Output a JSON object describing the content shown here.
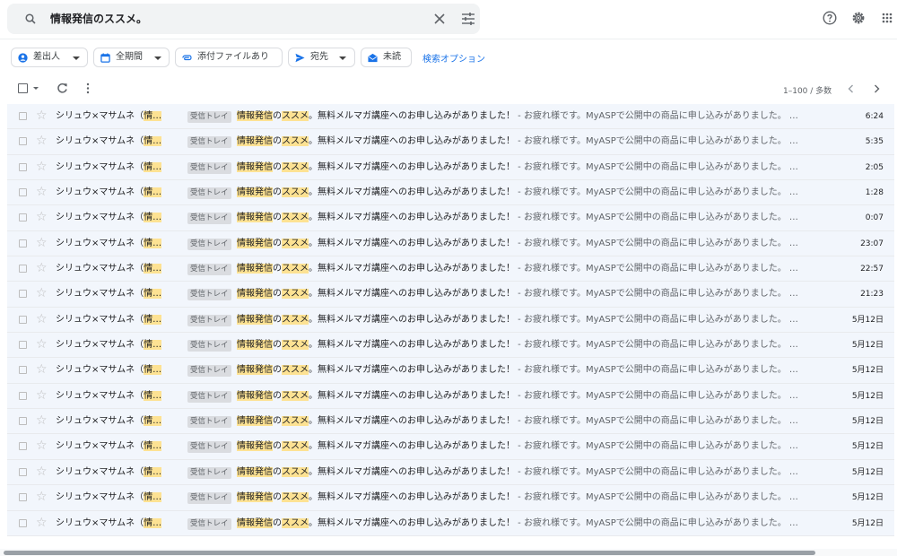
{
  "search": {
    "query": "情報発信のススメ。"
  },
  "filters": {
    "sender": "差出人",
    "period": "全期間",
    "attachment": "添付ファイルあり",
    "to": "宛先",
    "unread": "未読",
    "search_options": "検索オプション"
  },
  "pagination": {
    "label": "1–100 / 多数"
  },
  "colors": {
    "accent": "#1a73e8",
    "highlight": "#fde293",
    "row_bg": "#f2f6fc"
  },
  "icons": [
    "search-icon",
    "close-icon",
    "tune-icon",
    "help-icon",
    "gear-icon",
    "apps-icon",
    "person-icon",
    "calendar-icon",
    "attachment-icon",
    "send-icon",
    "unread-icon",
    "refresh-icon",
    "more-vert-icon",
    "chevron-left-icon",
    "chevron-right-icon",
    "star-icon"
  ],
  "emails": [
    {
      "sender_pre": "シリュウ×マサムネ（",
      "sender_hl": "情…",
      "label": "受信トレイ",
      "subj_hl1": "情報発信",
      "subj_mid": "の",
      "subj_hl2": "ススメ",
      "subj_rest": "。無料メルマガ講座へのお申し込みがありました！",
      "snippet": " - お疲れ様です。MyASPで公開中の商品に申し込みがありました。 …",
      "time": "6:24"
    },
    {
      "sender_pre": "シリュウ×マサムネ（",
      "sender_hl": "情…",
      "label": "受信トレイ",
      "subj_hl1": "情報発信",
      "subj_mid": "の",
      "subj_hl2": "ススメ",
      "subj_rest": "。無料メルマガ講座へのお申し込みがありました！",
      "snippet": " - お疲れ様です。MyASPで公開中の商品に申し込みがありました。 …",
      "time": "5:35"
    },
    {
      "sender_pre": "シリュウ×マサムネ（",
      "sender_hl": "情…",
      "label": "受信トレイ",
      "subj_hl1": "情報発信",
      "subj_mid": "の",
      "subj_hl2": "ススメ",
      "subj_rest": "。無料メルマガ講座へのお申し込みがありました！",
      "snippet": " - お疲れ様です。MyASPで公開中の商品に申し込みがありました。 …",
      "time": "2:05"
    },
    {
      "sender_pre": "シリュウ×マサムネ（",
      "sender_hl": "情…",
      "label": "受信トレイ",
      "subj_hl1": "情報発信",
      "subj_mid": "の",
      "subj_hl2": "ススメ",
      "subj_rest": "。無料メルマガ講座へのお申し込みがありました！",
      "snippet": " - お疲れ様です。MyASPで公開中の商品に申し込みがありました。 …",
      "time": "1:28"
    },
    {
      "sender_pre": "シリュウ×マサムネ（",
      "sender_hl": "情…",
      "label": "受信トレイ",
      "subj_hl1": "情報発信",
      "subj_mid": "の",
      "subj_hl2": "ススメ",
      "subj_rest": "。無料メルマガ講座へのお申し込みがありました！",
      "snippet": " - お疲れ様です。MyASPで公開中の商品に申し込みがありました。 …",
      "time": "0:07"
    },
    {
      "sender_pre": "シリュウ×マサムネ（",
      "sender_hl": "情…",
      "label": "受信トレイ",
      "subj_hl1": "情報発信",
      "subj_mid": "の",
      "subj_hl2": "ススメ",
      "subj_rest": "。無料メルマガ講座へのお申し込みがありました！",
      "snippet": " - お疲れ様です。MyASPで公開中の商品に申し込みがありました。 …",
      "time": "23:07"
    },
    {
      "sender_pre": "シリュウ×マサムネ（",
      "sender_hl": "情…",
      "label": "受信トレイ",
      "subj_hl1": "情報発信",
      "subj_mid": "の",
      "subj_hl2": "ススメ",
      "subj_rest": "。無料メルマガ講座へのお申し込みがありました！",
      "snippet": " - お疲れ様です。MyASPで公開中の商品に申し込みがありました。 …",
      "time": "22:57"
    },
    {
      "sender_pre": "シリュウ×マサムネ（",
      "sender_hl": "情…",
      "label": "受信トレイ",
      "subj_hl1": "情報発信",
      "subj_mid": "の",
      "subj_hl2": "ススメ",
      "subj_rest": "。無料メルマガ講座へのお申し込みがありました！",
      "snippet": " - お疲れ様です。MyASPで公開中の商品に申し込みがありました。 …",
      "time": "21:23"
    },
    {
      "sender_pre": "シリュウ×マサムネ（",
      "sender_hl": "情…",
      "label": "受信トレイ",
      "subj_hl1": "情報発信",
      "subj_mid": "の",
      "subj_hl2": "ススメ",
      "subj_rest": "。無料メルマガ講座へのお申し込みがありました！",
      "snippet": " - お疲れ様です。MyASPで公開中の商品に申し込みがありました。 …",
      "time": "5月12日"
    },
    {
      "sender_pre": "シリュウ×マサムネ（",
      "sender_hl": "情…",
      "label": "受信トレイ",
      "subj_hl1": "情報発信",
      "subj_mid": "の",
      "subj_hl2": "ススメ",
      "subj_rest": "。無料メルマガ講座へのお申し込みがありました！",
      "snippet": " - お疲れ様です。MyASPで公開中の商品に申し込みがありました。 …",
      "time": "5月12日"
    },
    {
      "sender_pre": "シリュウ×マサムネ（",
      "sender_hl": "情…",
      "label": "受信トレイ",
      "subj_hl1": "情報発信",
      "subj_mid": "の",
      "subj_hl2": "ススメ",
      "subj_rest": "。無料メルマガ講座へのお申し込みがありました！",
      "snippet": " - お疲れ様です。MyASPで公開中の商品に申し込みがありました。 …",
      "time": "5月12日"
    },
    {
      "sender_pre": "シリュウ×マサムネ（",
      "sender_hl": "情…",
      "label": "受信トレイ",
      "subj_hl1": "情報発信",
      "subj_mid": "の",
      "subj_hl2": "ススメ",
      "subj_rest": "。無料メルマガ講座へのお申し込みがありました！",
      "snippet": " - お疲れ様です。MyASPで公開中の商品に申し込みがありました。 …",
      "time": "5月12日"
    },
    {
      "sender_pre": "シリュウ×マサムネ（",
      "sender_hl": "情…",
      "label": "受信トレイ",
      "subj_hl1": "情報発信",
      "subj_mid": "の",
      "subj_hl2": "ススメ",
      "subj_rest": "。無料メルマガ講座へのお申し込みがありました！",
      "snippet": " - お疲れ様です。MyASPで公開中の商品に申し込みがありました。 …",
      "time": "5月12日"
    },
    {
      "sender_pre": "シリュウ×マサムネ（",
      "sender_hl": "情…",
      "label": "受信トレイ",
      "subj_hl1": "情報発信",
      "subj_mid": "の",
      "subj_hl2": "ススメ",
      "subj_rest": "。無料メルマガ講座へのお申し込みがありました！",
      "snippet": " - お疲れ様です。MyASPで公開中の商品に申し込みがありました。 …",
      "time": "5月12日"
    },
    {
      "sender_pre": "シリュウ×マサムネ（",
      "sender_hl": "情…",
      "label": "受信トレイ",
      "subj_hl1": "情報発信",
      "subj_mid": "の",
      "subj_hl2": "ススメ",
      "subj_rest": "。無料メルマガ講座へのお申し込みがありました！",
      "snippet": " - お疲れ様です。MyASPで公開中の商品に申し込みがありました。 …",
      "time": "5月12日"
    },
    {
      "sender_pre": "シリュウ×マサムネ（",
      "sender_hl": "情…",
      "label": "受信トレイ",
      "subj_hl1": "情報発信",
      "subj_mid": "の",
      "subj_hl2": "ススメ",
      "subj_rest": "。無料メルマガ講座へのお申し込みがありました！",
      "snippet": " - お疲れ様です。MyASPで公開中の商品に申し込みがありました。 …",
      "time": "5月12日"
    },
    {
      "sender_pre": "シリュウ×マサムネ（",
      "sender_hl": "情…",
      "label": "受信トレイ",
      "subj_hl1": "情報発信",
      "subj_mid": "の",
      "subj_hl2": "ススメ",
      "subj_rest": "。無料メルマガ講座へのお申し込みがありました！",
      "snippet": " - お疲れ様です。MyASPで公開中の商品に申し込みがありました。 …",
      "time": "5月12日"
    }
  ]
}
